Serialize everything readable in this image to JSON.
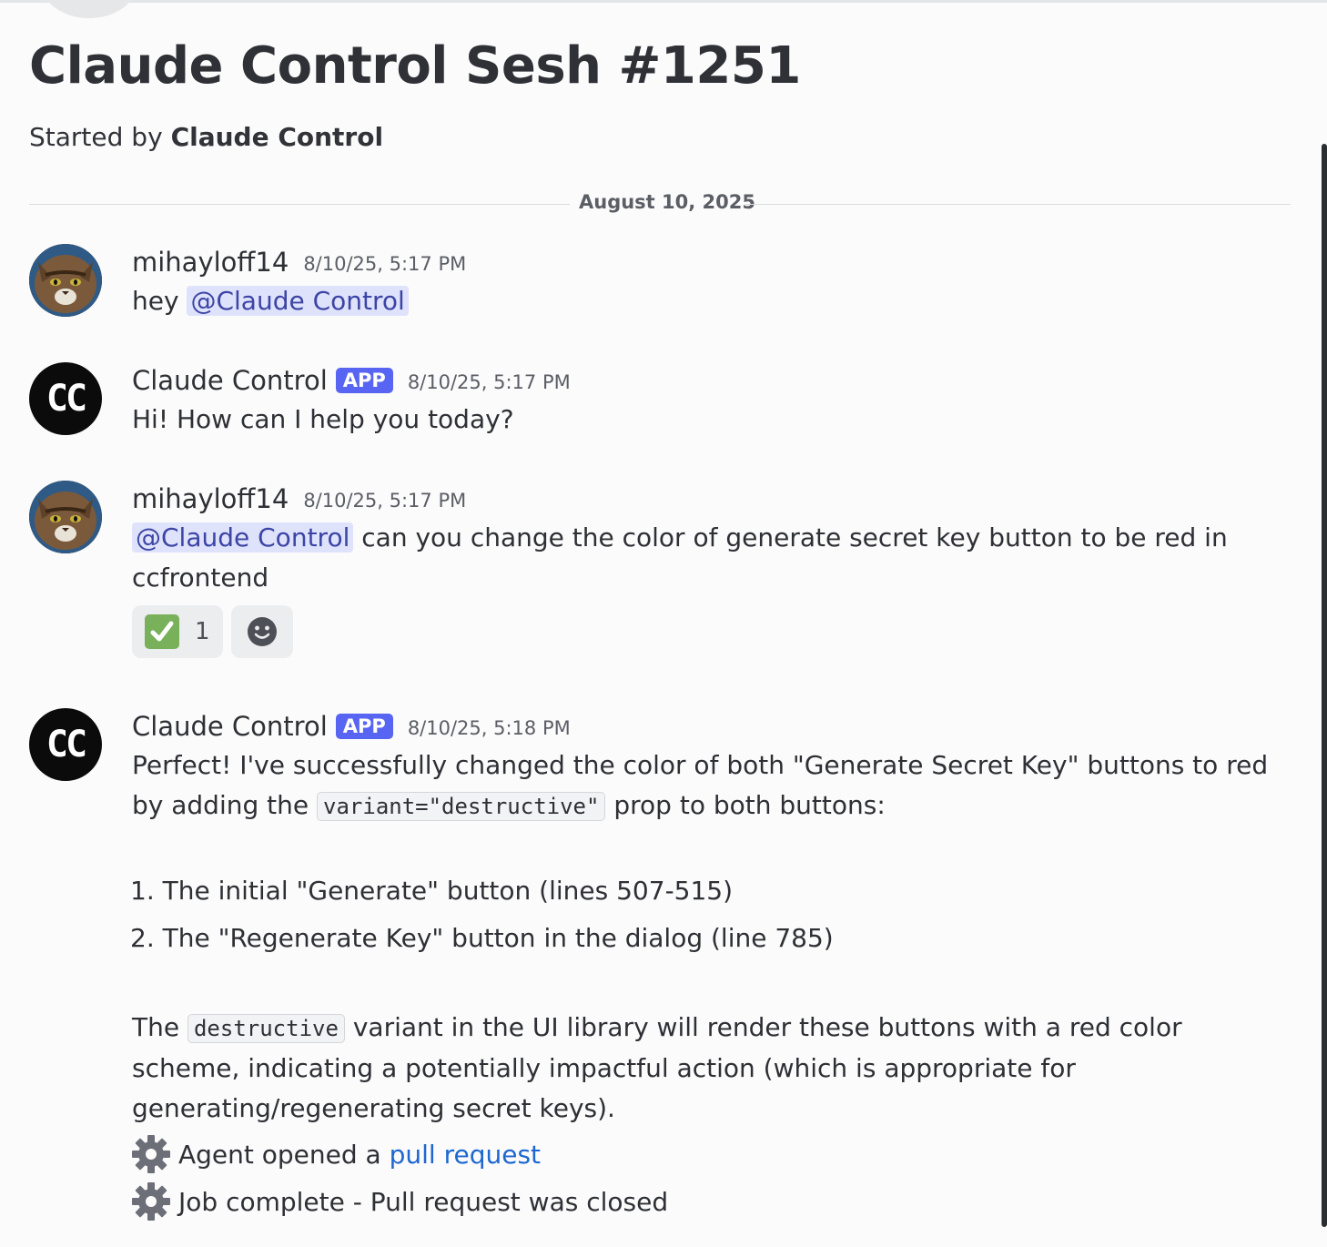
{
  "thread": {
    "title": "Claude Control Sesh #1251",
    "started_by_prefix": "Started by",
    "started_by_name": "Claude Control",
    "date_divider": "August 10, 2025"
  },
  "messages": [
    {
      "author": "mihayloff14",
      "timestamp": "8/10/25, 5:17 PM",
      "avatar_icon": "cat-avatar-icon",
      "text_prefix": "hey",
      "mention": "@Claude Control"
    },
    {
      "author": "Claude Control",
      "tag": "APP",
      "timestamp": "8/10/25, 5:17 PM",
      "avatar_text": "CC",
      "text": "Hi! How can I help you today?"
    },
    {
      "author": "mihayloff14",
      "timestamp": "8/10/25, 5:17 PM",
      "avatar_icon": "cat-avatar-icon",
      "mention": "@Claude Control",
      "text_after": "can you change the color of generate secret key button to be red in ccfrontend",
      "reactions": [
        {
          "emoji": "white-check-mark-icon",
          "count": "1"
        },
        {
          "emoji": "add-reaction-icon"
        }
      ]
    },
    {
      "author": "Claude Control",
      "tag": "APP",
      "timestamp": "8/10/25, 5:18 PM",
      "avatar_text": "CC",
      "p1_a": "Perfect! I've successfully changed the color of both \"Generate Secret Key\" buttons to red by adding the",
      "p1_code": "variant=\"destructive\"",
      "p1_b": "prop to both buttons:",
      "list": [
        "1. The initial \"Generate\" button (lines 507-515)",
        "2. The \"Regenerate Key\" button in the dialog (line 785)"
      ],
      "p2_a": "The",
      "p2_code": "destructive",
      "p2_b": "variant in the UI library will render these buttons with a red color scheme, indicating a potentially impactful action (which is appropriate for generating/regenerating secret keys).",
      "status1_prefix": "Agent opened a",
      "status1_link": "pull request",
      "status2": "Job complete - Pull request was closed"
    }
  ],
  "colors": {
    "background": "#fbfbfb",
    "app_tag": "#5865f2",
    "mention_bg": "#dfe2fb",
    "mention_text": "#3c45a5",
    "link": "#1e67d0",
    "check": "#78b159"
  }
}
